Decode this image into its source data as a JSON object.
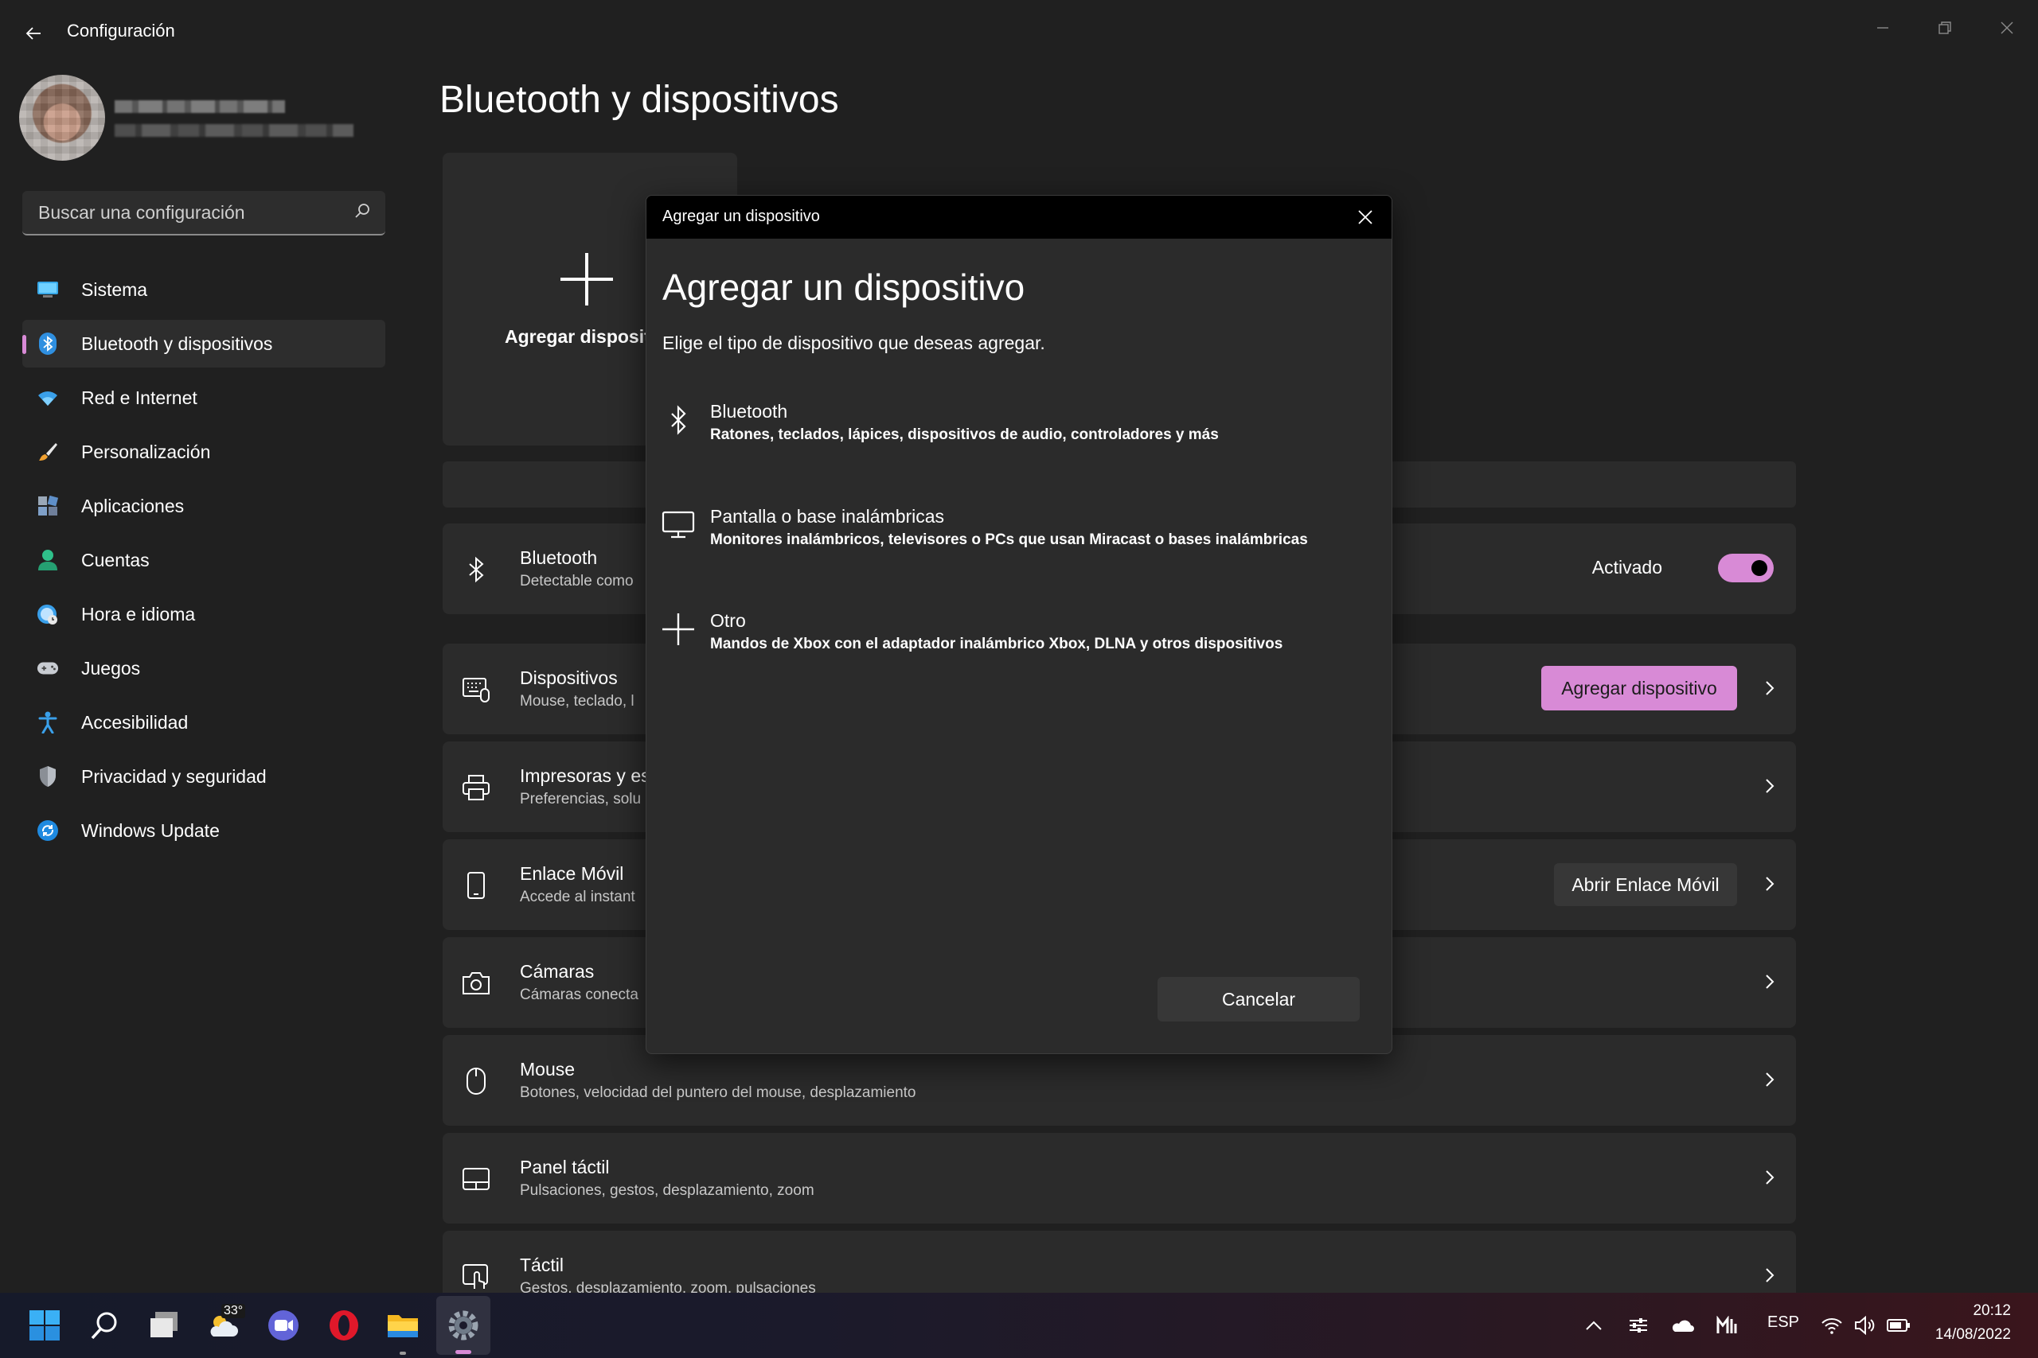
{
  "window": {
    "title": "Configuración"
  },
  "search": {
    "placeholder": "Buscar una configuración"
  },
  "sidebar": {
    "items": [
      {
        "label": "Sistema",
        "icon": "monitor-icon"
      },
      {
        "label": "Bluetooth y dispositivos",
        "icon": "bluetooth-icon",
        "active": true
      },
      {
        "label": "Red e Internet",
        "icon": "wifi-icon"
      },
      {
        "label": "Personalización",
        "icon": "brush-icon"
      },
      {
        "label": "Aplicaciones",
        "icon": "apps-icon"
      },
      {
        "label": "Cuentas",
        "icon": "person-icon"
      },
      {
        "label": "Hora e idioma",
        "icon": "globe-clock-icon"
      },
      {
        "label": "Juegos",
        "icon": "gamepad-icon"
      },
      {
        "label": "Accesibilidad",
        "icon": "accessibility-icon"
      },
      {
        "label": "Privacidad y seguridad",
        "icon": "shield-icon"
      },
      {
        "label": "Windows Update",
        "icon": "update-icon"
      }
    ]
  },
  "main": {
    "title": "Bluetooth y dispositivos",
    "add_card_label": "Agregar disposit",
    "rows": {
      "bluetooth": {
        "title": "Bluetooth",
        "subtitle": "Detectable como",
        "toggle_label": "Activado",
        "toggle_on": true
      },
      "devices": {
        "title": "Dispositivos",
        "subtitle": "Mouse, teclado, l",
        "button": "Agregar dispositivo"
      },
      "printers": {
        "title": "Impresoras y es",
        "subtitle": "Preferencias, solu"
      },
      "phone": {
        "title": "Enlace Móvil",
        "subtitle": "Accede al instant",
        "button": "Abrir Enlace Móvil"
      },
      "cameras": {
        "title": "Cámaras",
        "subtitle": "Cámaras conecta"
      },
      "mouse": {
        "title": "Mouse",
        "subtitle": "Botones, velocidad del puntero del mouse, desplazamiento"
      },
      "touchpad": {
        "title": "Panel táctil",
        "subtitle": "Pulsaciones, gestos, desplazamiento, zoom"
      },
      "touch": {
        "title": "Táctil",
        "subtitle": "Gestos, desplazamiento, zoom, pulsaciones"
      }
    }
  },
  "dialog": {
    "bar_title": "Agregar un dispositivo",
    "title": "Agregar un dispositivo",
    "description": "Elige el tipo de dispositivo que deseas agregar.",
    "options": [
      {
        "title": "Bluetooth",
        "subtitle": "Ratones, teclados, lápices, dispositivos de audio, controladores y más",
        "icon": "bluetooth-icon"
      },
      {
        "title": "Pantalla o base inalámbricas",
        "subtitle": "Monitores inalámbricos, televisores o PCs que usan Miracast o bases inalámbricas",
        "icon": "monitor-icon"
      },
      {
        "title": "Otro",
        "subtitle": "Mandos de Xbox con el adaptador inalámbrico Xbox, DLNA y otros dispositivos",
        "icon": "plus-icon"
      }
    ],
    "cancel": "Cancelar"
  },
  "taskbar": {
    "weather_temp": "33°",
    "language": "ESP",
    "time": "20:12",
    "date": "14/08/2022"
  },
  "colors": {
    "accent": "#d88ad6",
    "background": "#202020",
    "card": "#2b2b2b"
  }
}
